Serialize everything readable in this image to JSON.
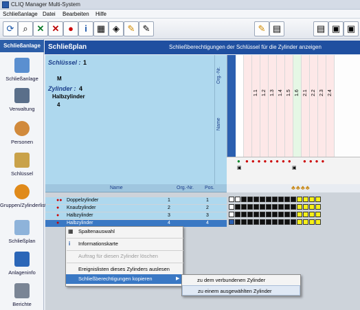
{
  "window": {
    "title": "CLIQ Manager Multi-System"
  },
  "menu": [
    "Schließanlage",
    "Datei",
    "Bearbeiten",
    "Hilfe"
  ],
  "sidebar": {
    "header": "Schließanlage",
    "items": [
      "Schließanlage",
      "Verwaltung",
      "Personen",
      "Schlüssel",
      "Gruppen/Zylinderliste",
      "Schließplan",
      "Anlageninfo",
      "Berichte"
    ]
  },
  "header": {
    "title": "Schließplan",
    "subtitle": "Schließberechtigungen der Schlüssel für die Zylinder anzeigen"
  },
  "info": {
    "key_label": "Schlüssel :",
    "key_value": "1",
    "m_label": "M",
    "cyl_label": "Zylinder :",
    "cyl_value": "4",
    "cyl_type": "Halbzylinder",
    "cyl_num": "4"
  },
  "vertical_headers": {
    "org": "Org.-Nr.",
    "name": "Name",
    "m": "M"
  },
  "grid_columns": [
    "1.1",
    "1.2",
    "1.3",
    "1.4",
    "1.5",
    "1.6",
    "2.1",
    "2.2",
    "2.3",
    "2.4"
  ],
  "table": {
    "headers": {
      "name": "Name",
      "org": "Org.-Nr.",
      "pos": "Pos."
    },
    "rows": [
      {
        "name": "Doppelzylinder",
        "org": "1",
        "pos": "1"
      },
      {
        "name": "Knaufzylinder",
        "org": "2",
        "pos": "2"
      },
      {
        "name": "Halbzylinder",
        "org": "3",
        "pos": "3"
      },
      {
        "name": "Halbzylinder",
        "org": "4",
        "pos": "4"
      }
    ]
  },
  "context_menu": {
    "items": [
      {
        "label": "Spaltenauswahl",
        "enabled": true
      },
      {
        "label": "Informationskarte",
        "enabled": true
      },
      {
        "label": "Auftrag für diesen Zylinder löschen",
        "enabled": false
      },
      {
        "label": "Ereignislisten dieses Zylinders auslesen",
        "enabled": true
      },
      {
        "label": "Schließberechtigungen kopieren",
        "enabled": true
      }
    ],
    "submenu": [
      "zu dem verbundenen Zylinder",
      "zu einem ausgewählten Zylinder"
    ]
  },
  "colors": {
    "accent": "#1f4fa0",
    "info_bg": "#aed8ee",
    "highlight": "#3a78c4"
  }
}
